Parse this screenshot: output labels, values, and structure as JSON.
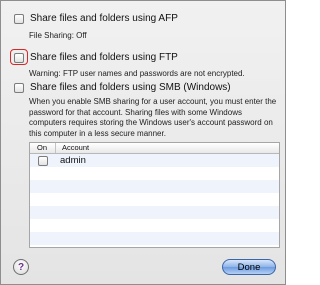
{
  "afp": {
    "label": "Share files and folders using AFP",
    "status": "File Sharing: Off"
  },
  "ftp": {
    "label": "Share files and folders using FTP",
    "warning": "Warning: FTP user names and passwords are not encrypted."
  },
  "smb": {
    "label": "Share files and folders using SMB (Windows)",
    "description": "When you enable SMB sharing for a user account, you must enter the password for that account. Sharing files with some Windows computers requires storing the Windows user's account password on this computer in a less secure manner."
  },
  "accounts_table": {
    "columns": {
      "on": "On",
      "account": "Account"
    },
    "rows": [
      {
        "account": "admin",
        "on": false
      }
    ]
  },
  "help_button": {
    "label": "?"
  },
  "done_button": {
    "label": "Done"
  },
  "colors": {
    "highlight": "#d62828",
    "done_button": "#6c9be0",
    "alt_row": "#eef3fc"
  }
}
